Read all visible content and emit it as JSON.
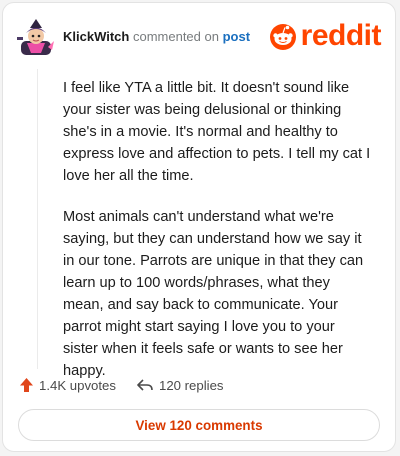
{
  "header": {
    "username": "KlickWitch",
    "action_text": "commented on",
    "post_link": "post",
    "logo_text": "reddit"
  },
  "comment": {
    "paragraphs": [
      "I feel like YTA a little bit. It doesn't sound like your sister was being delusional or thinking she's in a movie. It's normal and healthy to express love and affection to pets. I tell my cat I love her all the time.",
      "Most animals can't understand what we're saying, but they can understand how we say it in our tone. Parrots are unique in that they can learn up to 100 words/phrases, what they mean, and say back to communicate. Your parrot might start saying I love you to your sister when it feels safe or wants to see her happy."
    ]
  },
  "actions": {
    "upvotes": "1.4K upvotes",
    "replies": "120 replies"
  },
  "footer": {
    "view_comments": "View 120 comments"
  },
  "colors": {
    "brand": "#ff4500",
    "link": "#1a6fbf",
    "upvote": "#e0461b"
  },
  "icons": {
    "avatar": "avatar",
    "logo": "reddit-logo-icon",
    "upvote": "upvote-arrow-icon",
    "reply": "reply-arrow-icon"
  }
}
